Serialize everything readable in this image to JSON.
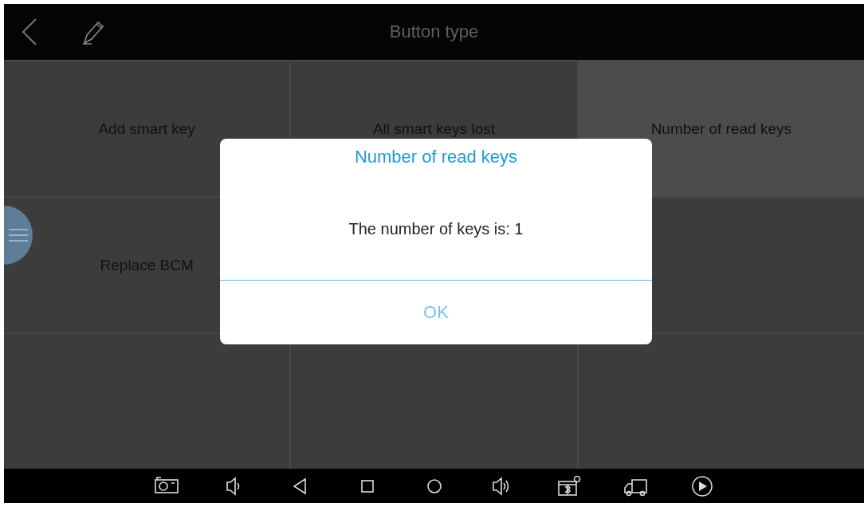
{
  "top_bar": {
    "title": "Button type"
  },
  "cells": [
    {
      "label": "Add smart key",
      "selected": false
    },
    {
      "label": "All smart keys lost",
      "selected": false
    },
    {
      "label": "Number of read keys",
      "selected": true
    },
    {
      "label": "Replace BCM",
      "selected": false
    }
  ],
  "dialog": {
    "title": "Number of read keys",
    "message": "The number of keys is: 1",
    "button": "OK"
  }
}
